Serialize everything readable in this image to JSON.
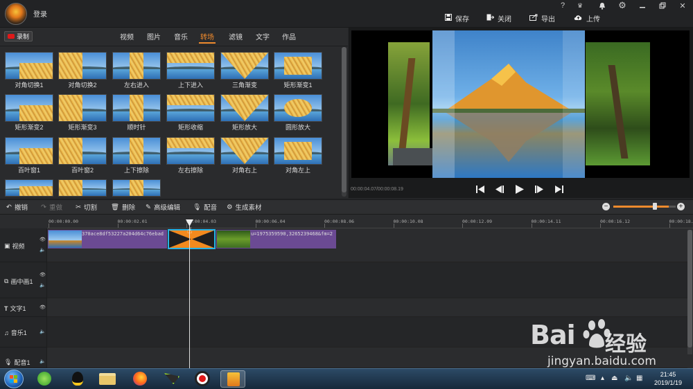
{
  "header": {
    "login": "登录",
    "window_controls": [
      "?",
      "VIP",
      "bell",
      "gear",
      "minimize",
      "restore",
      "close"
    ],
    "actions": [
      {
        "label": "保存",
        "icon": "save-icon"
      },
      {
        "label": "关闭",
        "icon": "exit-icon"
      },
      {
        "label": "导出",
        "icon": "export-icon"
      },
      {
        "label": "上传",
        "icon": "upload-icon"
      }
    ]
  },
  "media": {
    "record_label": "录制",
    "tabs": [
      "视频",
      "图片",
      "音乐",
      "转场",
      "滤镜",
      "文字",
      "作品"
    ],
    "active_tab": "转场",
    "transitions": [
      "对角切换1",
      "对角切换2",
      "左右进入",
      "上下进入",
      "三角渐变",
      "矩形渐变1",
      "矩形渐变2",
      "矩形渐变3",
      "顺时针",
      "矩形收缩",
      "矩形放大",
      "圆形放大",
      "百叶窗1",
      "百叶窗2",
      "上下擦除",
      "左右擦除",
      "对角右上",
      "对角左上",
      "",
      "",
      ""
    ]
  },
  "preview": {
    "timecode": "00:00:04.07/00:00:08.19",
    "controls": [
      "skip-start",
      "step-back",
      "play",
      "step-forward",
      "skip-end"
    ]
  },
  "toolbar": {
    "undo": "撤销",
    "redo": "重做",
    "cut": "切割",
    "delete": "删除",
    "advanced_edit": "高级编辑",
    "dub": "配音",
    "generate": "生成素材"
  },
  "timeline": {
    "ticks": [
      "00:00:00.00",
      "00:00:02.01",
      "00:00:04.03",
      "00:00:06.04",
      "00:00:08.06",
      "00:00:10.08",
      "00:00:12.09",
      "00:00:14.11",
      "00:00:16.12",
      "00:00:18.1"
    ],
    "tracks": [
      "视频",
      "画中画1",
      "文字1",
      "音乐1",
      "配音1"
    ],
    "clips": [
      {
        "text": "370ace8df53227a204d64c76ebad"
      },
      {
        "text": "u=1975359590,3265239468&fm=2"
      }
    ]
  },
  "taskbar": {
    "apps": [
      "start",
      "360-browser",
      "qq",
      "file-explorer",
      "firefox",
      "video-app",
      "recorder",
      "video-editor"
    ],
    "time": "21:45",
    "date": "2019/1/19"
  },
  "watermark": {
    "brand": "Bai",
    "brand_tail": "经验",
    "url": "jingyan.baidu.com"
  }
}
